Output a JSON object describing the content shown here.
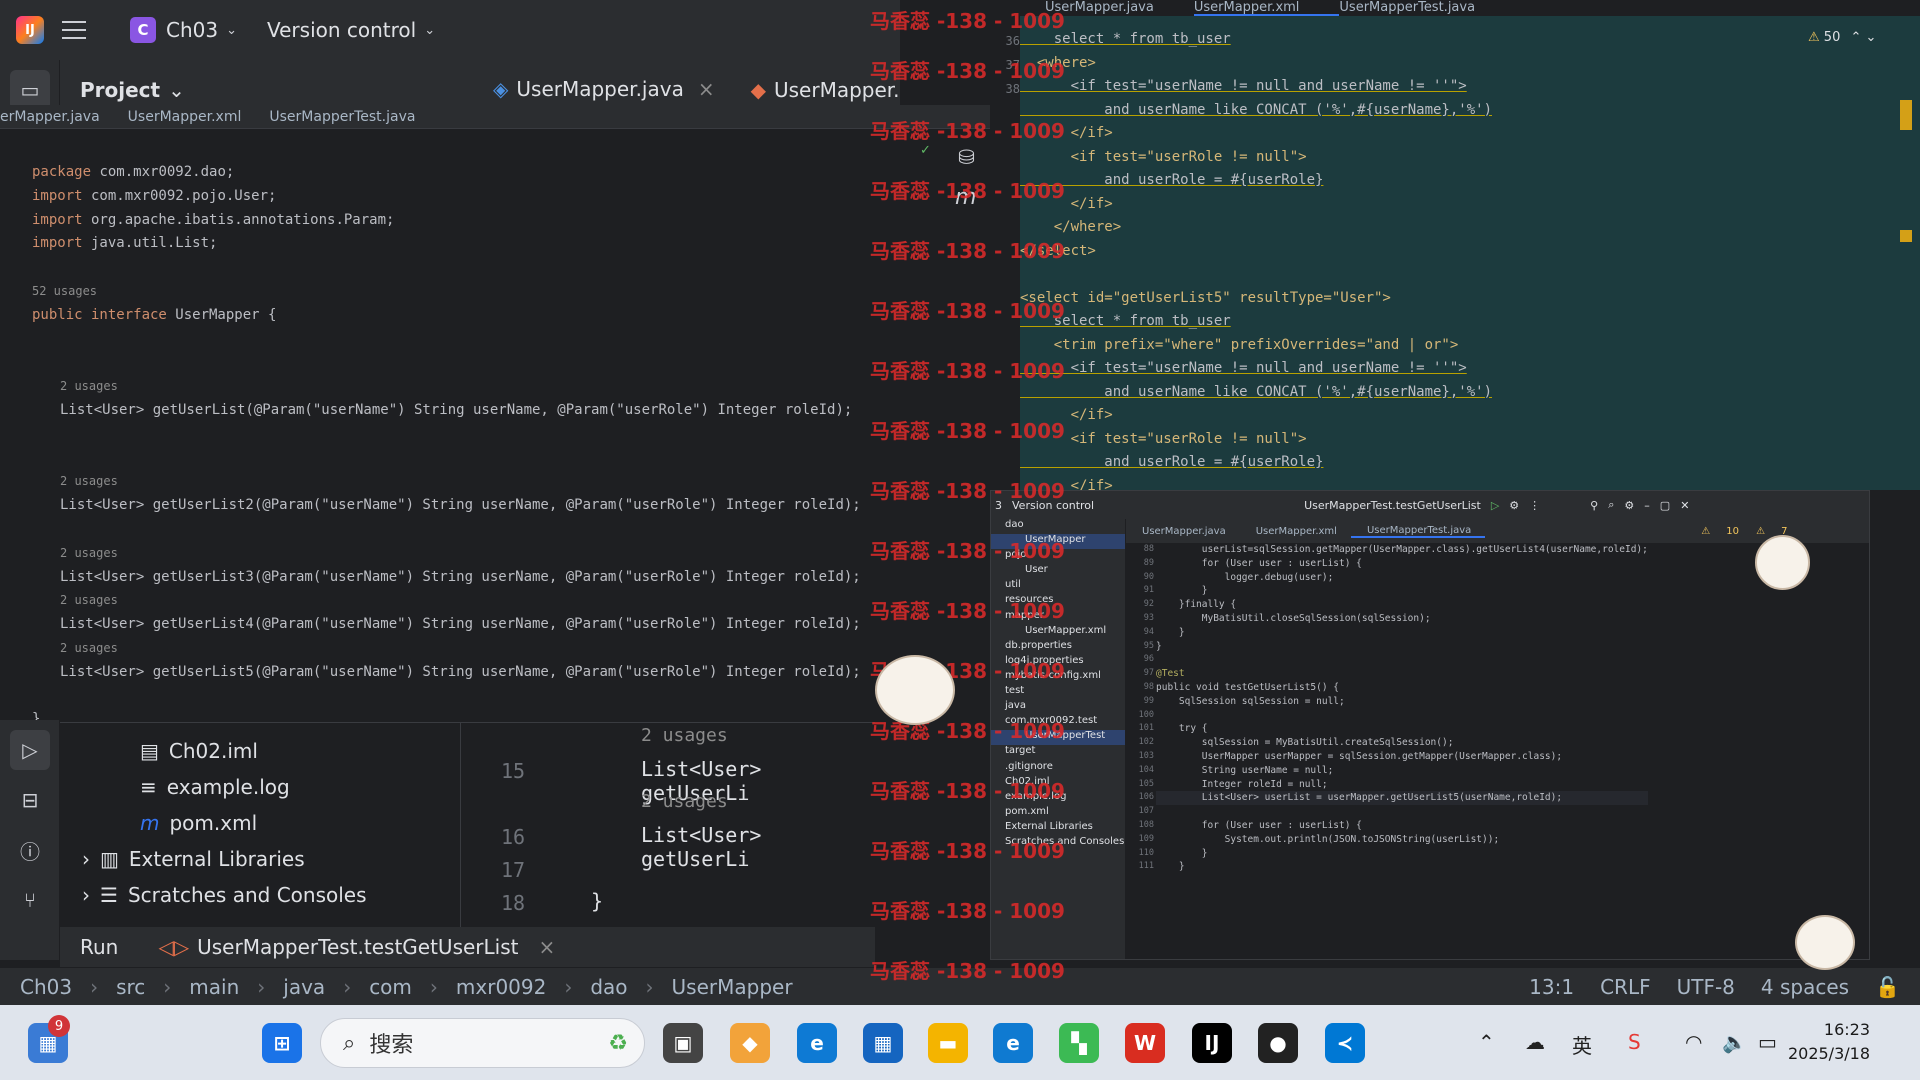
{
  "ide": {
    "project_badge": "C",
    "project_name": "Ch03",
    "vcs_label": "Version control",
    "project_panel_title": "Project"
  },
  "editor_main": {
    "tabs": [
      "UserMapper.java",
      "UserMapper.x"
    ],
    "inner_tabs": [
      "erMapper.java",
      "UserMapper.xml",
      "UserMapperTest.java"
    ],
    "lines": [
      "package com.mxr0092.dao;",
      "import com.mxr0092.pojo.User;",
      "import org.apache.ibatis.annotations.Param;",
      "import java.util.List;",
      "",
      "52 usages",
      "public interface UserMapper {",
      "",
      "",
      "2 usages",
      "List<User> getUserList(@Param(\"userName\") String userName, @Param(\"userRole\") Integer roleId);",
      "",
      "",
      "2 usages",
      "List<User> getUserList2(@Param(\"userName\") String userName, @Param(\"userRole\") Integer roleId);",
      "",
      "2 usages",
      "List<User> getUserList3(@Param(\"userName\") String userName, @Param(\"userRole\") Integer roleId);",
      "2 usages",
      "List<User> getUserList4(@Param(\"userName\") String userName, @Param(\"userRole\") Integer roleId);",
      "2 usages",
      "List<User> getUserList5(@Param(\"userName\") String userName, @Param(\"userRole\") Integer roleId);",
      "",
      "}"
    ]
  },
  "editor_xml": {
    "tabs": [
      "UserMapper.java",
      "UserMapper.xml",
      "UserMapperTest.java"
    ],
    "line_numbers": [
      "36",
      "37",
      "38"
    ],
    "warning_count": "50",
    "lines": [
      "    select * from tb_user",
      "  <where>",
      "      <if test=\"userName != null and userName != ''\">",
      "          and userName like CONCAT ('%',#{userName},'%')",
      "      </if>",
      "      <if test=\"userRole != null\">",
      "          and userRole = #{userRole}",
      "      </if>",
      "    </where>",
      "</select>",
      "",
      "<select id=\"getUserList5\" resultType=\"User\">",
      "    select * from tb_user",
      "    <trim prefix=\"where\" prefixOverrides=\"and | or\">",
      "      <if test=\"userName != null and userName != ''\">",
      "          and userName like CONCAT ('%',#{userName},'%')",
      "      </if>",
      "      <if test=\"userRole != null\">",
      "          and userRole = #{userRole}",
      "      </if>"
    ]
  },
  "project_tree_bottom": {
    "items": [
      "Ch02.iml",
      "example.log",
      "pom.xml",
      "External Libraries",
      "Scratches and Consoles"
    ],
    "line_numbers": [
      "15",
      "16",
      "17",
      "18"
    ],
    "code": [
      "2 usages",
      "List<User> getUserLi",
      "2 usages",
      "List<User> getUserLi",
      "",
      "}"
    ]
  },
  "run_bar": {
    "label": "Run",
    "config": "UserMapperTest.testGetUserList"
  },
  "status_bar": {
    "breadcrumb": [
      "Ch03",
      "src",
      "main",
      "java",
      "com",
      "mxr0092",
      "dao",
      "UserMapper"
    ],
    "position": "13:1",
    "line_sep": "CRLF",
    "encoding": "UTF-8",
    "indent": "4 spaces"
  },
  "mini_window": {
    "project": "3",
    "vcs": "Version control",
    "run_config": "UserMapperTest.testGetUserList",
    "tabs": [
      "UserMapper.java",
      "UserMapper.xml",
      "UserMapperTest.java"
    ],
    "warnings": "10",
    "weak_warnings": "7",
    "tree": [
      "dao",
      "UserMapper",
      "pojo",
      "User",
      "util",
      "resources",
      "mapper",
      "UserMapper.xml",
      "db.properties",
      "log4j.properties",
      "mybatis-config.xml",
      "test",
      "java",
      "com.mxr0092.test",
      "UserMapperTest",
      "target",
      ".gitignore",
      "Ch02.iml",
      "example.log",
      "pom.xml",
      "External Libraries",
      "Scratches and Consoles"
    ],
    "line_numbers": [
      "88",
      "89",
      "90",
      "91",
      "92",
      "93",
      "94",
      "95",
      "96",
      "97",
      "98",
      "99",
      "100",
      "101",
      "102",
      "103",
      "104",
      "105",
      "106",
      "107",
      "108",
      "109",
      "110",
      "111"
    ],
    "code": [
      "        userList=sqlSession.getMapper(UserMapper.class).getUserList4(userName,roleId);",
      "        for (User user : userList) {",
      "            logger.debug(user);",
      "        }",
      "    }finally {",
      "        MyBatisUtil.closeSqlSession(sqlSession);",
      "    }",
      "}",
      "",
      "@Test",
      "public void testGetUserList5() {",
      "    SqlSession sqlSession = null;",
      "",
      "    try {",
      "        sqlSession = MyBatisUtil.createSqlSession();",
      "        UserMapper userMapper = sqlSession.getMapper(UserMapper.class);",
      "        String userName = null;",
      "        Integer roleId = null;",
      "        List<User> userList = userMapper.getUserList5(userName,roleId);",
      "",
      "        for (User user : userList) {",
      "            System.out.println(JSON.toJSONString(userList));",
      "        }",
      "    }"
    ]
  },
  "watermark": "马香蕊 -138 - 1009",
  "taskbar": {
    "badge": "9",
    "search_placeholder": "搜索",
    "time": "16:23",
    "date": "2025/3/18",
    "ime": "英"
  }
}
